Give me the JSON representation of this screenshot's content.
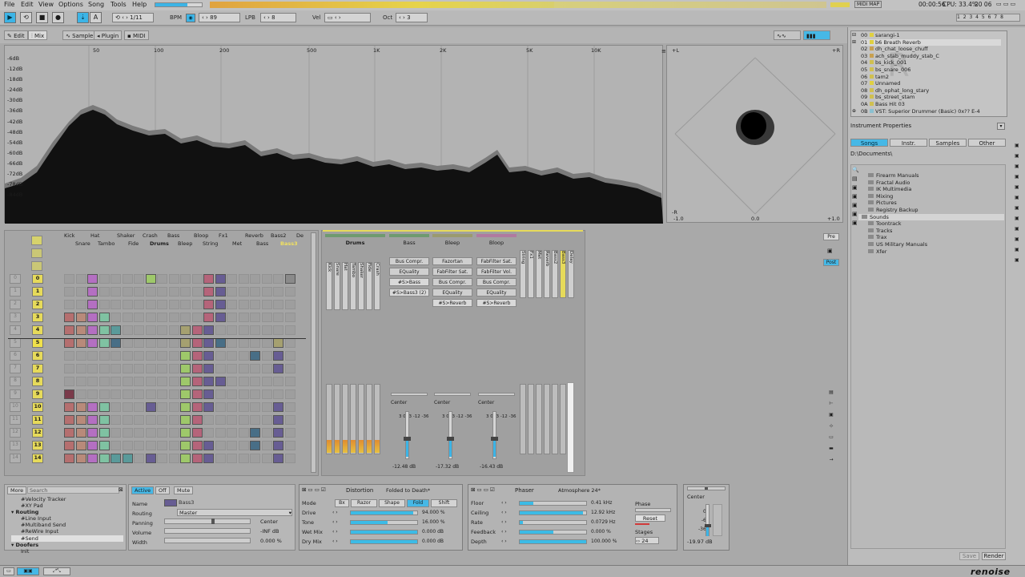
{
  "menu": [
    "File",
    "Edit",
    "View",
    "Options",
    "Song",
    "Tools",
    "Help"
  ],
  "status": {
    "midi": "MIDI MAP",
    "time": "00:00:56",
    "cpu": "CPU: 33.4%",
    "clock": "20 06"
  },
  "transport": {
    "play": "▶",
    "loop": "⟲",
    "stop": "■",
    "rec": "●",
    "follow": "⇣",
    "pattern_label": "1/11",
    "bpm_label": "BPM",
    "bpm": "89",
    "lpb_label": "LPB",
    "lpb": "8",
    "vel_label": "Vel",
    "oct_label": "Oct",
    "oct": "3"
  },
  "tabs": [
    "Edit",
    "Mix",
    "Sampler",
    "Plugin",
    "MIDI"
  ],
  "spectrum": {
    "freq_labels": [
      "50",
      "100",
      "200",
      "500",
      "1K",
      "2K",
      "5K",
      "10K"
    ],
    "db_labels": [
      "-6dB",
      "-12dB",
      "-18dB",
      "-24dB",
      "-30dB",
      "-36dB",
      "-42dB",
      "-48dB",
      "-54dB",
      "-60dB",
      "-66dB",
      "-72dB",
      "-78dB",
      "-84dB"
    ]
  },
  "scope": {
    "l": "+L",
    "r": "+R",
    "bottom": [
      "-1.0",
      "0.0",
      "+1.0"
    ],
    "side": "-R"
  },
  "instruments": [
    "sarangi-1",
    "b6 Breath Reverb",
    "dh_chat_loose_chuff",
    "ach_stab_muddy_stab_C",
    "bs_kick_001",
    "bs_snare_006",
    "tam2",
    "Unnamed",
    "dh_ophat_long_stary",
    "bs_street_stam",
    "Bass Hit 03",
    "VST: Superior Drummer (Basic) 0x?? E-4"
  ],
  "instr_nums": [
    "00",
    "01",
    "02",
    "03",
    "04",
    "05",
    "06",
    "07",
    "08",
    "09",
    "0A",
    "0B"
  ],
  "instr_props": "Instrument Properties",
  "browser_tabs": [
    "Songs",
    "Instr.",
    "Samples",
    "Other"
  ],
  "browser_path": "D:\\Documents\\",
  "folders": [
    "Firearm Manuals",
    "Fractal Audio",
    "IK Multimedia",
    "Mixing",
    "Pictures",
    "Registry Backup",
    "Sounds",
    "Toontrack",
    "Tracks",
    "Trax",
    "US Military Manuals",
    "Xfer"
  ],
  "browser_buttons": [
    "Save",
    "Render"
  ],
  "pattern_tracks_top": [
    "Kick",
    "Hat",
    "Shaker",
    "Crash",
    "Bass",
    "Bloop",
    "Fx1",
    "Reverb",
    "Bass2",
    "De"
  ],
  "pattern_tracks_bottom": [
    "Snare",
    "Tambo",
    "Fide",
    "Drums",
    "Bleep",
    "String",
    "Met",
    "Bass",
    "Bass3"
  ],
  "pattern_rows": [
    "0",
    "1",
    "2",
    "3",
    "4",
    "5",
    "6",
    "7",
    "8",
    "9",
    "10",
    "11",
    "12",
    "13",
    "14"
  ],
  "mixer": {
    "groups": [
      "Drums",
      "Bass",
      "Bleep",
      "Bloop"
    ],
    "bass_fx": [
      "Bus Compr.",
      "EQuality",
      "#S>Bass",
      "#S>Bass3 (2)"
    ],
    "bleep_fx": [
      "Fazortan",
      "FabFilter Sat.",
      "Bus Compr.",
      "EQuality",
      "#S>Reverb"
    ],
    "bloop_fx": [
      "FabFilter Sat.",
      "FabFilter Vol.",
      "Bus Compr.",
      "EQuality",
      "#S>Reverb"
    ],
    "center": "Center",
    "db": [
      "-12.48 dB",
      "-17.32 dB",
      "-16.43 dB"
    ],
    "scale": [
      "3",
      "0",
      "-3",
      "-12",
      "-36"
    ],
    "drum_tracks": [
      "Kick",
      "Snare",
      "Hat",
      "Tambo",
      "Shaker",
      "Fide",
      "Crash"
    ],
    "right_tracks": [
      "String",
      "Fx1",
      "Met",
      "Reverb",
      "Bass2",
      "Bass3",
      "Delay"
    ],
    "pre": "Pre",
    "post": "Post"
  },
  "dsp_list": {
    "more": "More",
    "search": "Search",
    "items": [
      "#Velocity Tracker",
      "#XY Pad",
      "Routing",
      "#Line Input",
      "#Multiband Send",
      "#ReWire Input",
      "#Send",
      "Doofers",
      "Init"
    ]
  },
  "track_props": {
    "tabs": [
      "Active",
      "Off",
      "Mute"
    ],
    "name_label": "Name",
    "name": "Bass3",
    "routing_label": "Routing",
    "routing": "Master",
    "panning_label": "Panning",
    "panning": "Center",
    "volume_label": "Volume",
    "volume": "-INF dB",
    "width_label": "Width",
    "width": "0.000 %"
  },
  "distortion": {
    "title": "Distortion",
    "preset": "Folded to Death*",
    "mode_label": "Mode",
    "modes": [
      "Bx",
      "Razor",
      "Shape",
      "Fold",
      "Shift"
    ],
    "params": [
      {
        "l": "Drive",
        "v": "94.000 %"
      },
      {
        "l": "Tone",
        "v": "16.000 %"
      },
      {
        "l": "Wet Mix",
        "v": "0.000 dB"
      },
      {
        "l": "Dry Mix",
        "v": "0.000 dB"
      }
    ]
  },
  "phaser": {
    "title": "Phaser",
    "preset": "Atmosphere 24*",
    "params": [
      {
        "l": "Floor",
        "v": "0.41 kHz"
      },
      {
        "l": "Ceiling",
        "v": "12.92 kHz"
      },
      {
        "l": "Rate",
        "v": "0.0729 Hz"
      },
      {
        "l": "Feedback",
        "v": "0.000 %"
      },
      {
        "l": "Depth",
        "v": "100.000 %"
      }
    ],
    "phase": "Phase",
    "reset": "Reset",
    "stages": "Stages",
    "stages_val": "24"
  },
  "master": {
    "center": "Center",
    "scale": [
      "0",
      "-6",
      "-36"
    ],
    "db": "-19.97 dB"
  },
  "logo": "renoise"
}
